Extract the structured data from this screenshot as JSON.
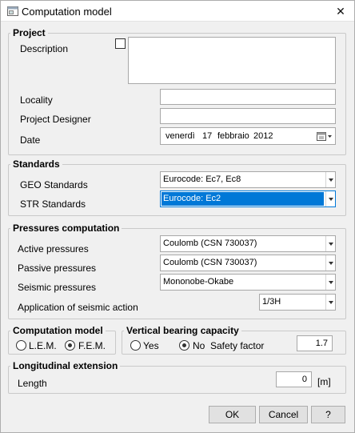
{
  "window": {
    "title": "Computation model",
    "close_glyph": "✕"
  },
  "project": {
    "legend": "Project",
    "description_label": "Description",
    "locality_label": "Locality",
    "designer_label": "Project Designer",
    "date_label": "Date",
    "locality_value": "",
    "designer_value": "",
    "date_weekday": "venerdì",
    "date_day": "17",
    "date_month": "febbraio",
    "date_year": "2012"
  },
  "standards": {
    "legend": "Standards",
    "geo_label": "GEO Standards",
    "geo_value": "Eurocode: Ec7, Ec8",
    "str_label": "STR Standards",
    "str_value": "Eurocode: Ec2"
  },
  "pressures": {
    "legend": "Pressures computation",
    "active_label": "Active pressures",
    "active_value": "Coulomb (CSN 730037)",
    "passive_label": "Passive pressures",
    "passive_value": "Coulomb (CSN 730037)",
    "seismic_label": "Seismic pressures",
    "seismic_value": "Mononobe-Okabe",
    "application_label": "Application of seismic action",
    "application_value": "1/3H"
  },
  "computation_model": {
    "legend": "Computation model",
    "lem_label": "L.E.M.",
    "fem_label": "F.E.M.",
    "selected": "F.E.M."
  },
  "vertical_bearing": {
    "legend": "Vertical bearing capacity",
    "yes_label": "Yes",
    "no_label": "No",
    "selected": "No",
    "safety_factor_label": "Safety factor",
    "safety_factor_value": "1.7"
  },
  "longitudinal": {
    "legend": "Longitudinal extension",
    "length_label": "Length",
    "length_value": "0",
    "length_unit": "[m]"
  },
  "buttons": {
    "ok": "OK",
    "cancel": "Cancel",
    "help": "?"
  },
  "colors": {
    "selection": "#0078d7",
    "window_bg": "#f0f0f0"
  },
  "icons": {
    "app": "window-icon",
    "calendar": "calendar-icon"
  }
}
